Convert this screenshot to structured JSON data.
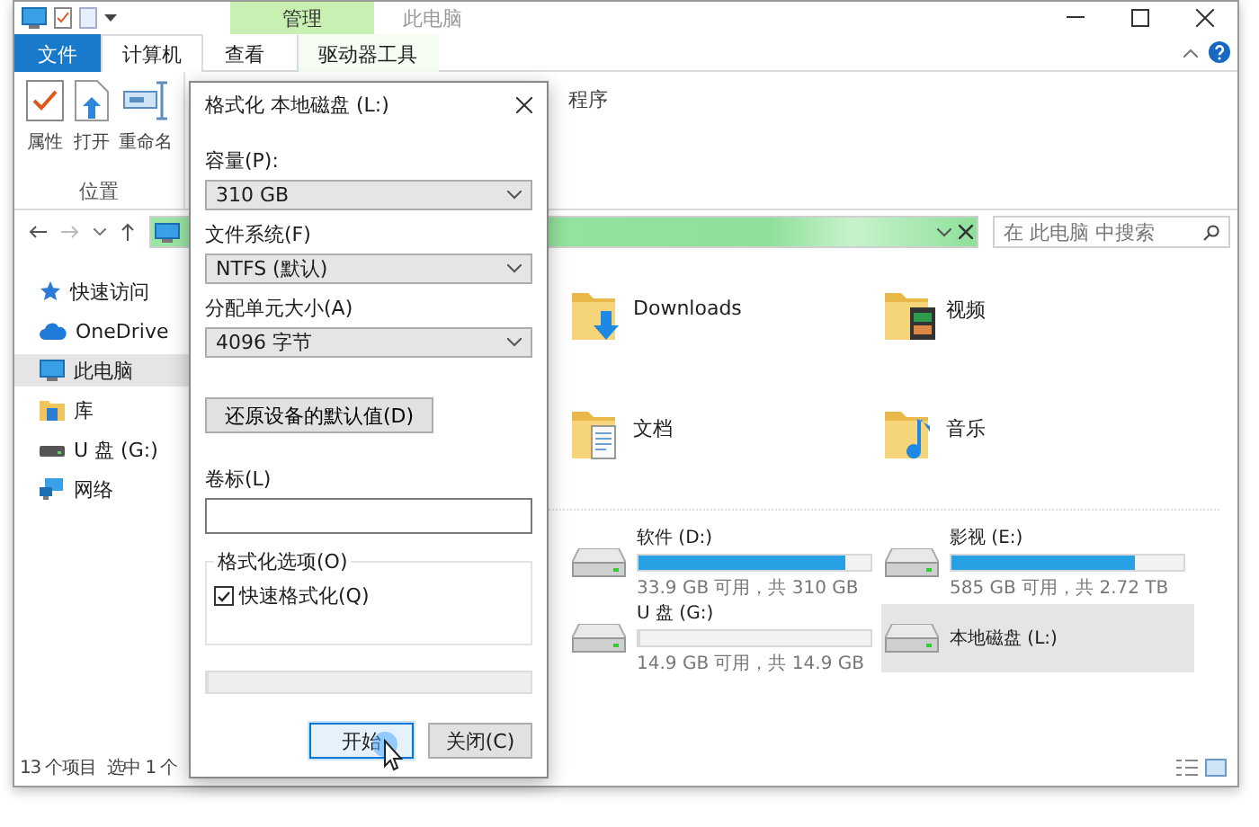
{
  "window": {
    "title": "此电脑",
    "context_tab": "管理"
  },
  "ribbon": {
    "tabs": [
      {
        "label": "文件",
        "kind": "file",
        "selected": false
      },
      {
        "label": "计算机",
        "kind": "tab",
        "selected": true
      },
      {
        "label": "查看",
        "kind": "tab",
        "selected": false
      },
      {
        "label": "驱动器工具",
        "kind": "context",
        "selected": false
      }
    ],
    "buttons": [
      {
        "label": "属性",
        "kind": "properties"
      },
      {
        "label": "打开",
        "kind": "open"
      },
      {
        "label": "重命名",
        "kind": "rename"
      }
    ],
    "group_label": "位置",
    "partial_button": "程序"
  },
  "address_bar": {
    "search_placeholder": "在 此电脑 中搜索"
  },
  "sidebar": {
    "items": [
      {
        "label": "快速访问",
        "kind": "quick",
        "selected": false
      },
      {
        "label": "OneDrive",
        "kind": "cloud",
        "selected": false
      },
      {
        "label": "此电脑",
        "kind": "computer",
        "selected": true
      },
      {
        "label": "库",
        "kind": "library",
        "selected": false
      },
      {
        "label": "U 盘 (G:)",
        "kind": "usb",
        "selected": false
      },
      {
        "label": "网络",
        "kind": "network",
        "selected": false
      }
    ]
  },
  "folders": [
    {
      "name": "Downloads",
      "kind": "downloads"
    },
    {
      "name": "视频",
      "kind": "video"
    },
    {
      "name": "文档",
      "kind": "documents"
    },
    {
      "name": "音乐",
      "kind": "music"
    }
  ],
  "drives": [
    {
      "name": "软件 (D:)",
      "level": 0.89,
      "info": "33.9 GB 可用，共 310 GB",
      "selected": false
    },
    {
      "name": "影视 (E:)",
      "level": 0.79,
      "info": "585 GB 可用，共 2.72 TB",
      "selected": false
    },
    {
      "name": "U 盘 (G:)",
      "level": 0,
      "info": "14.9 GB 可用，共 14.9 GB",
      "selected": false
    },
    {
      "name": "本地磁盘 (L:)",
      "selected": true
    }
  ],
  "status_bar": {
    "count": "13 个项目",
    "selection": "选中 1 个"
  },
  "dialog": {
    "title": "格式化 本地磁盘 (L:)",
    "fields": [
      {
        "label": "容量(P):",
        "value": "310 GB"
      },
      {
        "label": "文件系统(F)",
        "value": "NTFS (默认)"
      },
      {
        "label": "分配单元大小(A)",
        "value": "4096 字节"
      }
    ],
    "restore_button": "还原设备的默认值(D)",
    "volume_label": {
      "label": "卷标(L)"
    },
    "options": {
      "title": "格式化选项(O)",
      "quick_format": {
        "label": "快速格式化(Q)",
        "checked": true
      }
    },
    "progress": {
      "level": 0
    },
    "buttons": [
      {
        "label": "开始",
        "focused": true
      },
      {
        "label": "关闭(C)",
        "focused": false
      }
    ]
  }
}
